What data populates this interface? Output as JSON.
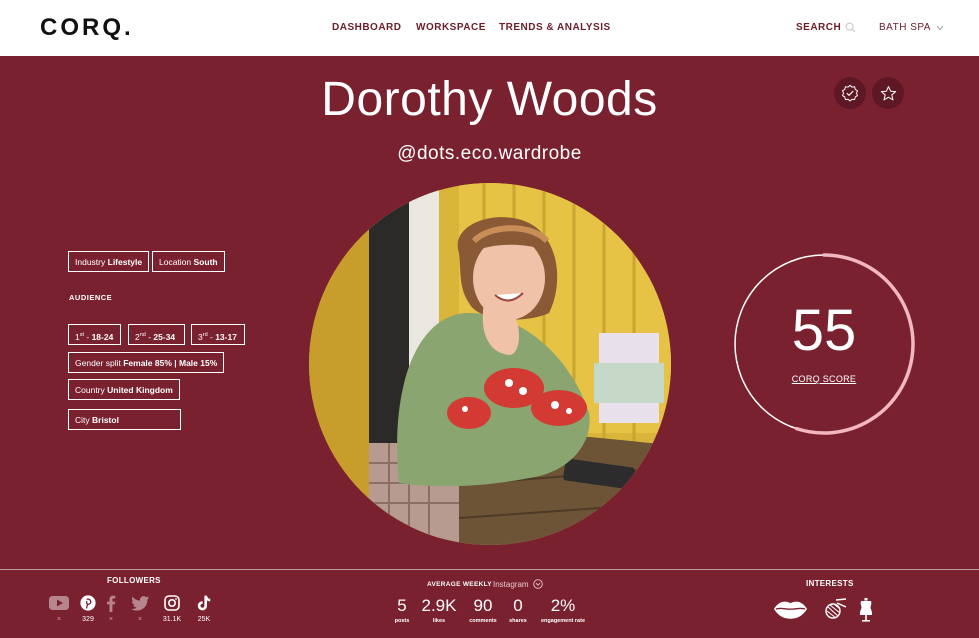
{
  "header": {
    "logo": "CORQ.",
    "nav": [
      "DASHBOARD",
      "WORKSPACE",
      "TRENDS & ANALYSIS"
    ],
    "search_label": "SEARCH",
    "user_menu": "BATH SPA"
  },
  "profile": {
    "name": "Dorothy Woods",
    "handle": "@dots.eco.wardrobe"
  },
  "details": {
    "industry_label": "Industry",
    "industry_value": "Lifestyle",
    "location_label": "Location",
    "location_value": "South",
    "audience_title": "AUDIENCE",
    "ages": [
      {
        "rank": "1",
        "suffix": "st",
        "range": "18-24"
      },
      {
        "rank": "2",
        "suffix": "nd",
        "range": "25-34"
      },
      {
        "rank": "3",
        "suffix": "rd",
        "range": "13-17"
      }
    ],
    "gender_label": "Gender split",
    "gender_value": "Female 85% | Male 15%",
    "country_label": "Country",
    "country_value": "United Kingdom",
    "city_label": "City",
    "city_value": "Bristol"
  },
  "score": {
    "value": "55",
    "label": "CORQ SCORE",
    "fraction": 0.55
  },
  "followers": {
    "title": "FOLLOWERS",
    "platforms": [
      {
        "icon": "youtube-icon",
        "count": "×"
      },
      {
        "icon": "pinterest-icon",
        "count": "329"
      },
      {
        "icon": "facebook-icon",
        "count": "×"
      },
      {
        "icon": "twitter-icon",
        "count": "×"
      },
      {
        "icon": "instagram-icon",
        "count": "31.1K"
      },
      {
        "icon": "tiktok-icon",
        "count": "25K"
      }
    ]
  },
  "weekly": {
    "title": "AVERAGE WEEKLY",
    "platform": "Instagram",
    "stats": [
      {
        "value": "5",
        "label": "posts"
      },
      {
        "value": "2.9K",
        "label": "likes"
      },
      {
        "value": "90",
        "label": "comments"
      },
      {
        "value": "0",
        "label": "shares"
      },
      {
        "value": "2%",
        "label": "engagement rate"
      }
    ]
  },
  "interests": {
    "title": "INTERESTS",
    "items": [
      "lips-icon",
      "knitting-icon",
      "dress-form-icon"
    ]
  },
  "colors": {
    "background": "#7a2130",
    "header": "#ffffff",
    "nav_text": "#6b1d2a",
    "score_ring_accent": "#f2b7c0"
  }
}
